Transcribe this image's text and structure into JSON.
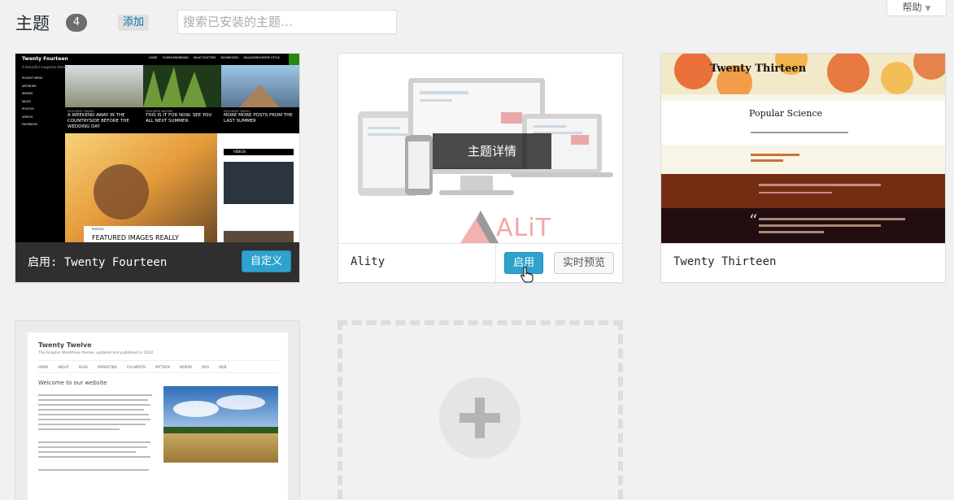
{
  "header": {
    "title": "主题",
    "count": "4",
    "add_label": "添加",
    "search_placeholder": "搜索已安装的主题…",
    "help_label": "帮助"
  },
  "themes": {
    "fourteen": {
      "active_label": "启用: Twenty Fourteen",
      "customize_label": "自定义",
      "preview": {
        "site_title": "Twenty Fourteen",
        "tagline": "A beautiful magazine theme",
        "nav": [
          "HOME",
          "OVERVIEW/BRAND",
          "WHAT MATTERS",
          "BUSINESSES",
          "MAGAZINES/MORE STYLE"
        ],
        "sidebar": [
          "POCKET MENU",
          "ARTWORK",
          "WORKS",
          "MUSIC",
          "PHOTOS",
          "VIDEOS",
          "FACEBOOK"
        ],
        "featured_captions": [
          "A WEEKEND AWAY IN THE COUNTRYSIDE BEFORE THE WEDDING DAY",
          "THIS IS IT FOR NOW. SEE YOU ALL NEXT SUMMER.",
          "MORE MORE POSTS FROM THE LAST SUMMER"
        ],
        "featured_tags": [
          "FEATURED TRAVEL",
          "FEATURED NATURE",
          "FEATURED TRAVEL"
        ],
        "article_tag": "PHOTOS",
        "article_title": "FEATURED IMAGES REALLY",
        "videos_label": "VIDEOS"
      }
    },
    "ality": {
      "name": "Ality",
      "details_label": "主题详情",
      "activate_label": "启用",
      "live_preview_label": "实时预览",
      "brand_text": "ALiT"
    },
    "thirteen": {
      "name": "Twenty Thirteen",
      "preview": {
        "site_title": "Twenty Thirteen",
        "post_title": "Popular Science",
        "quote_mark": "“"
      }
    },
    "twelve": {
      "preview": {
        "site_title": "Twenty Twelve",
        "tagline": "The Graphic WordPress theme, updated and published in 2012",
        "nav": [
          "HOME",
          "ABOUT",
          "BLOG",
          "MARKETING",
          "FULLWIDTH",
          "PATTERN",
          "WORDS",
          "MUS",
          "WEB"
        ],
        "post_title": "Welcome to our website"
      }
    }
  },
  "add_new_label": "+",
  "colors": {
    "primary_button": "#2ea2cc",
    "active_bar": "#2f2f2f",
    "fourteen_green": "#24890d"
  }
}
